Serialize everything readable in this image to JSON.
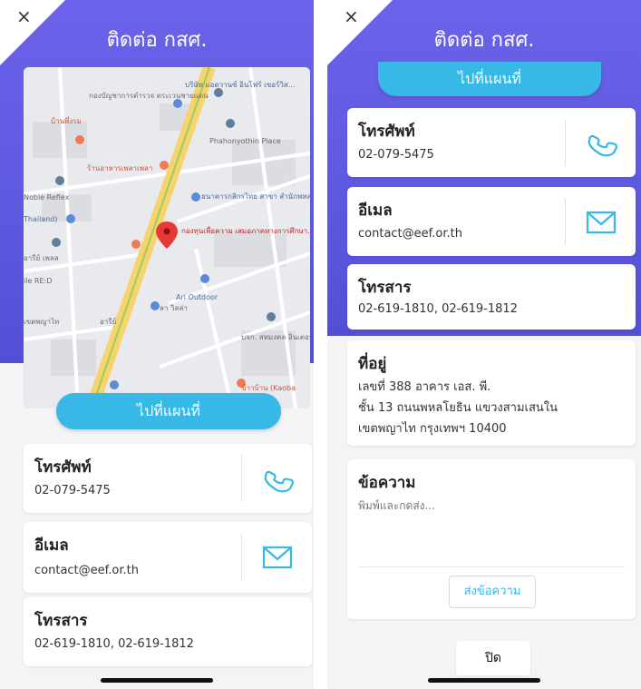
{
  "left": {
    "close": "×",
    "title": "ติดต่อ กสศ.",
    "map": {
      "labels": {
        "dept": "กองบัญชาการตำรวจ ตระเวนชายแดน",
        "company": "บริษัท แอดวานซ์ อินโฟร์ เซอร์วิส...",
        "ban": "บ้านพึ่งรม",
        "phahonyothin": "Phahonyothin Place",
        "restaurant": "ร้านอาหารเพลาเพลา",
        "reflex": "Noble Reflex",
        "thailand": "Thailand)",
        "kbank": "ธนาคารกสิกรไทย สาขา สำนักพหลโยธิน",
        "eef": "กองทุนเพื่อความ เสมอภาคทางการศึกษา...",
        "ari_village": "อารีย์ เพลส",
        "rede": "ile RE:D",
        "ari_outdoor": "Ari Outdoor",
        "lavilla": "ลา วิลล่า",
        "ari": "อารีย์",
        "phayathai": "เขตพญาไท",
        "company2": "บจก. สหมงคล อินเตอร์เนชั่น",
        "khaoban": "ข้าวบ้าน (Kaoba"
      }
    },
    "map_button": "ไปที่แผนที่",
    "phone": {
      "label": "โทรศัพท์",
      "value": "02-079-5475"
    },
    "email": {
      "label": "อีเมล",
      "value": "contact@eef.or.th"
    },
    "fax": {
      "label": "โทรสาร",
      "value": "02-619-1810, 02-619-1812"
    }
  },
  "right": {
    "close": "×",
    "title": "ติดต่อ กสศ.",
    "map_button": "ไปที่แผนที่",
    "phone": {
      "label": "โทรศัพท์",
      "value": "02-079-5475"
    },
    "email": {
      "label": "อีเมล",
      "value": "contact@eef.or.th"
    },
    "fax": {
      "label": "โทรสาร",
      "value": "02-619-1810, 02-619-1812"
    },
    "address": {
      "label": "ที่อยู่",
      "line1": "เลขที่ 388 อาคาร เอส. พี.",
      "line2": "ชั้น 13 ถนนพหลโยธิน แขวงสามเสนใน",
      "line3": "เขตพญาไท กรุงเทพฯ 10400"
    },
    "message": {
      "label": "ข้อความ",
      "placeholder": "พิมพ์และกดส่ง...",
      "value": "",
      "send_button": "ส่งข้อความ"
    },
    "close_button": "ปิด"
  },
  "colors": {
    "gradient_top": "#6b63ea",
    "gradient_bottom": "#524fd6",
    "accent": "#37b8e6",
    "map_pin": "#e53935"
  },
  "icons": {
    "close": "close-icon",
    "phone": "phone-icon",
    "email": "mail-icon",
    "pin": "map-pin-icon"
  }
}
